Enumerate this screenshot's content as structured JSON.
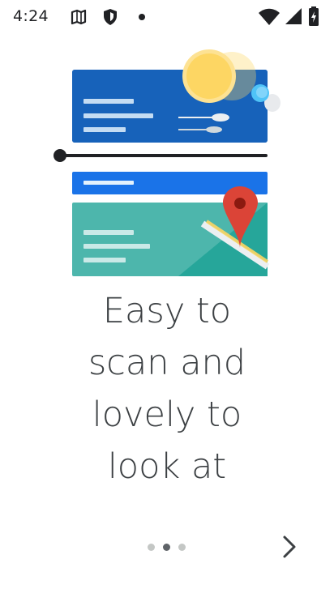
{
  "status_bar": {
    "time": "4:24",
    "icons": [
      "gps-icon",
      "shield-icon",
      "notification-dot-icon",
      "wifi-icon",
      "cellular-signal-icon",
      "battery-icon"
    ]
  },
  "onboarding": {
    "headline_lines": [
      "Easy to",
      "scan and",
      "lovely to",
      "look at"
    ],
    "page_indicator": {
      "total": 3,
      "current": 2
    },
    "next_icon": "chevron-right-icon"
  },
  "colors": {
    "text": "#3c4043",
    "card_blue": "#1a5fb4",
    "bar_blue": "#1a73e8",
    "card_green": "#4db6ac",
    "map_red": "#db4437",
    "sun": "#fdd663",
    "dot_active": "#5f6368",
    "dot_inactive": "#c4c7c5"
  }
}
